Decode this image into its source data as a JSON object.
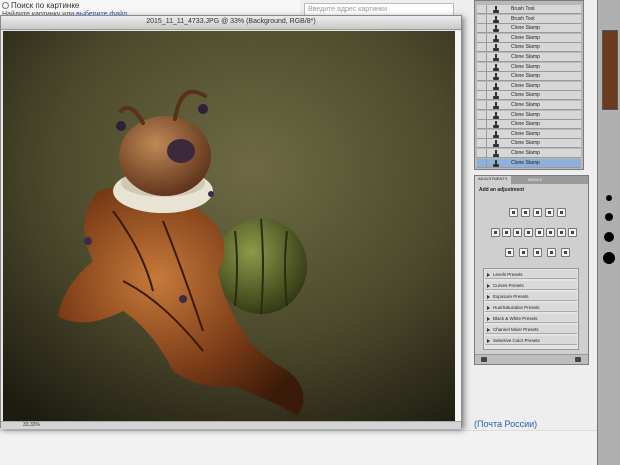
{
  "web": {
    "search_label": "Поиск по картинке",
    "hint_before": "Найдите картинку или ",
    "hint_link": "выберите файл",
    "address_placeholder": "Введите адрес картинки",
    "bottom_title": "(Почта России)"
  },
  "document": {
    "title": "2015_11_11_4733.JPG @ 33% (Background, RGB/8*)",
    "zoom": "33.33%"
  },
  "layers": {
    "rows": [
      "Brush Tool",
      "Brush Tool",
      "Clone Stamp",
      "Clone Stamp",
      "Clone Stamp",
      "Clone Stamp",
      "Clone Stamp",
      "Clone Stamp",
      "Clone Stamp",
      "Clone Stamp",
      "Clone Stamp",
      "Clone Stamp",
      "Clone Stamp",
      "Clone Stamp",
      "Clone Stamp",
      "Clone Stamp",
      "Clone Stamp"
    ]
  },
  "adjustments": {
    "tab_active": "ADJUSTMENTS",
    "tab_other": "MASKS",
    "heading": "Add an adjustment",
    "presets": [
      "Levels Presets",
      "Curves Presets",
      "Exposure Presets",
      "Hue/Saturation Presets",
      "Black & White Presets",
      "Channel Mixer Presets",
      "Selective Color Presets"
    ]
  },
  "colors": {
    "accent_selection": "#8fb0dd",
    "panel_gray": "#b8b8b8",
    "link_blue": "#2a5db0"
  },
  "icons": {
    "layer_brush": "brush-icon",
    "layer_visibility": "eye-icon",
    "preset_expand": "disclosure-triangle-icon"
  }
}
